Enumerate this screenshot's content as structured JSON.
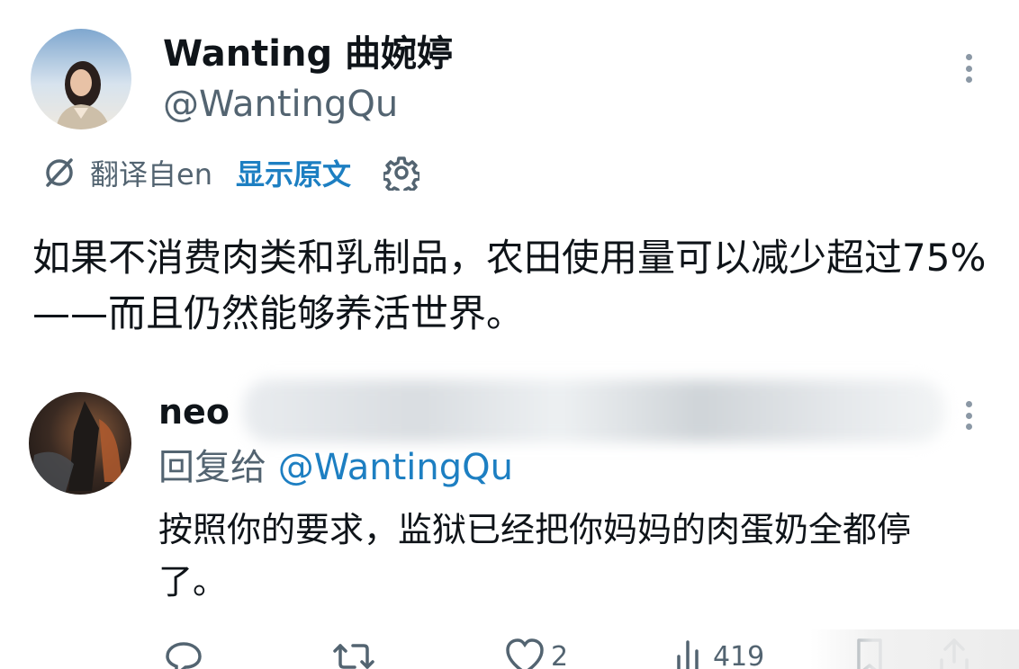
{
  "tweet": {
    "author": {
      "name": "Wanting 曲婉婷",
      "handle": "@WantingQu"
    },
    "translation": {
      "translated_from": "翻译自en",
      "show_original": "显示原文"
    },
    "text": "如果不消费肉类和乳制品，农田使用量可以减少超过75%——而且仍然能够养活世界。"
  },
  "reply": {
    "author": {
      "name": "neo"
    },
    "replying_to_prefix": "回复给",
    "replying_to_handle": "@WantingQu",
    "text": "按照你的要求，监狱已经把你妈妈的肉蛋奶全都停了。",
    "actions": {
      "likes": "2",
      "views": "419"
    }
  },
  "icons": {
    "more": "more-vertical-icon",
    "translate": "translate-icon",
    "settings": "gear-icon",
    "reply": "reply-icon",
    "retweet": "retweet-icon",
    "like": "heart-icon",
    "views": "views-icon",
    "bookmark": "bookmark-icon",
    "share": "share-icon"
  },
  "colors": {
    "link": "#1d7fc2",
    "secondary_text": "#536471",
    "primary_text": "#0f1419"
  }
}
